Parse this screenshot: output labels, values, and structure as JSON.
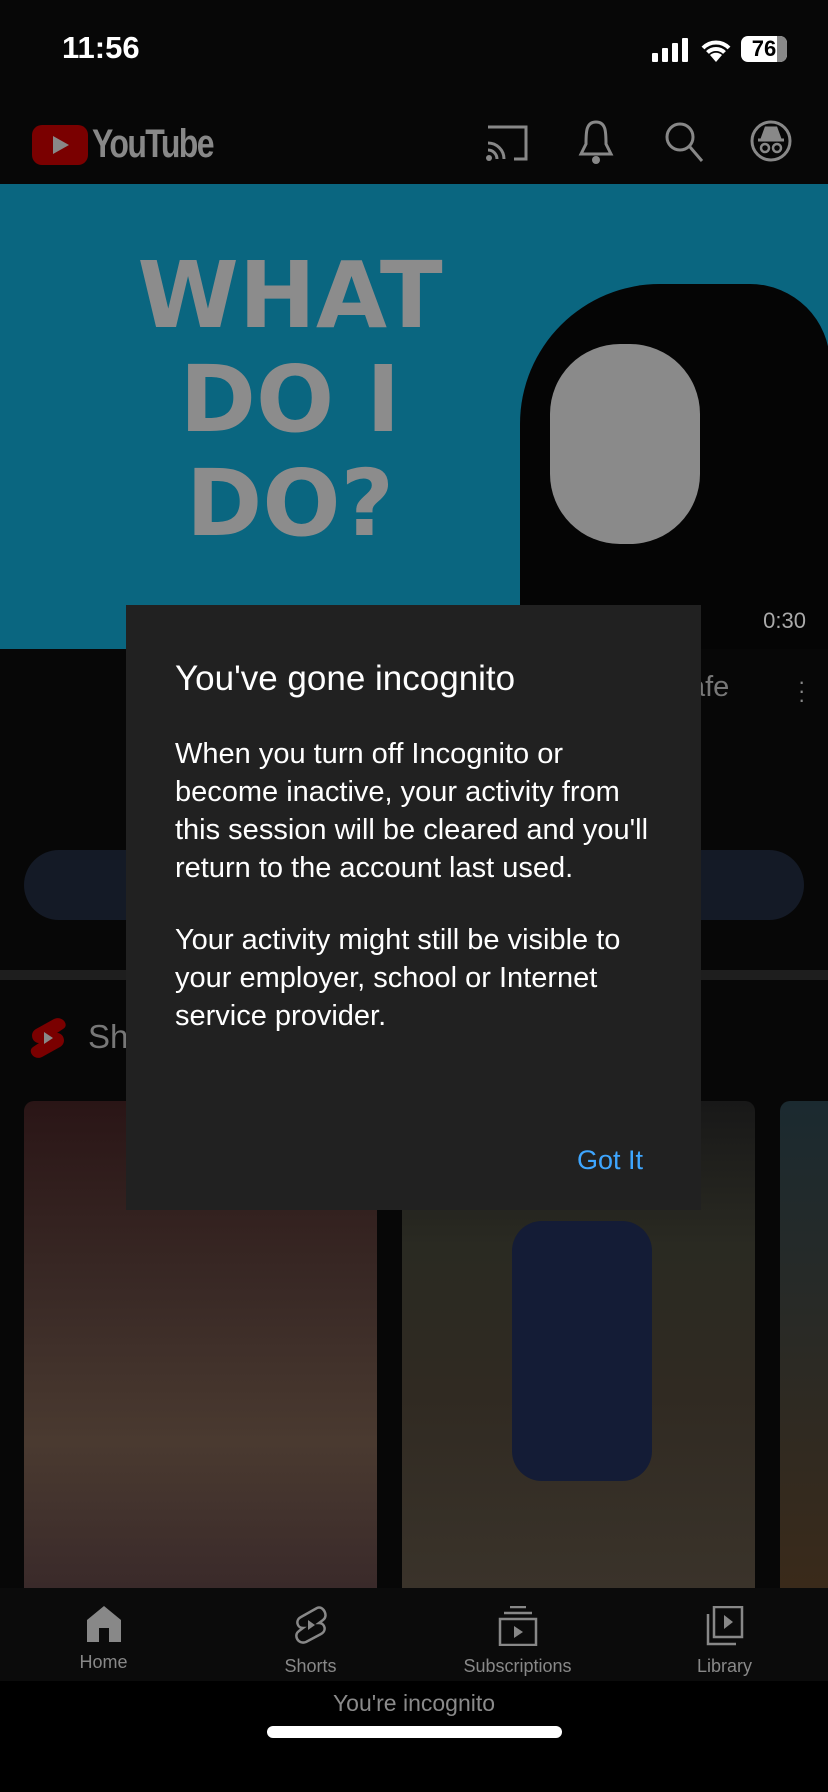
{
  "status_bar": {
    "time": "11:56",
    "battery": "76"
  },
  "header": {
    "logo_text": "YouTube",
    "brand_color": "#cc0000",
    "icons": [
      "cast-icon",
      "bell-icon",
      "search-icon",
      "incognito-icon"
    ]
  },
  "video": {
    "thumbnail_text": [
      "WHAT",
      "DO I",
      "DO?"
    ],
    "duration": "0:30",
    "title_fragment": "afe"
  },
  "shorts": {
    "section_label_fragment": "Sh"
  },
  "dialog": {
    "title": "You've gone incognito",
    "paragraphs": [
      "When you turn off Incognito or become inactive, your activity from this session will be cleared and you'll return to the account last used.",
      "Your activity might still be visible to your employer, school or Internet service provider."
    ],
    "confirm_label": "Got It",
    "accent": "#3ea6ff"
  },
  "bottom_nav": {
    "items": [
      {
        "label": "Home",
        "icon": "home-icon"
      },
      {
        "label": "Shorts",
        "icon": "shorts-icon"
      },
      {
        "label": "Subscriptions",
        "icon": "subscriptions-icon"
      },
      {
        "label": "Library",
        "icon": "library-icon"
      }
    ]
  },
  "incognito_banner": "You're incognito"
}
